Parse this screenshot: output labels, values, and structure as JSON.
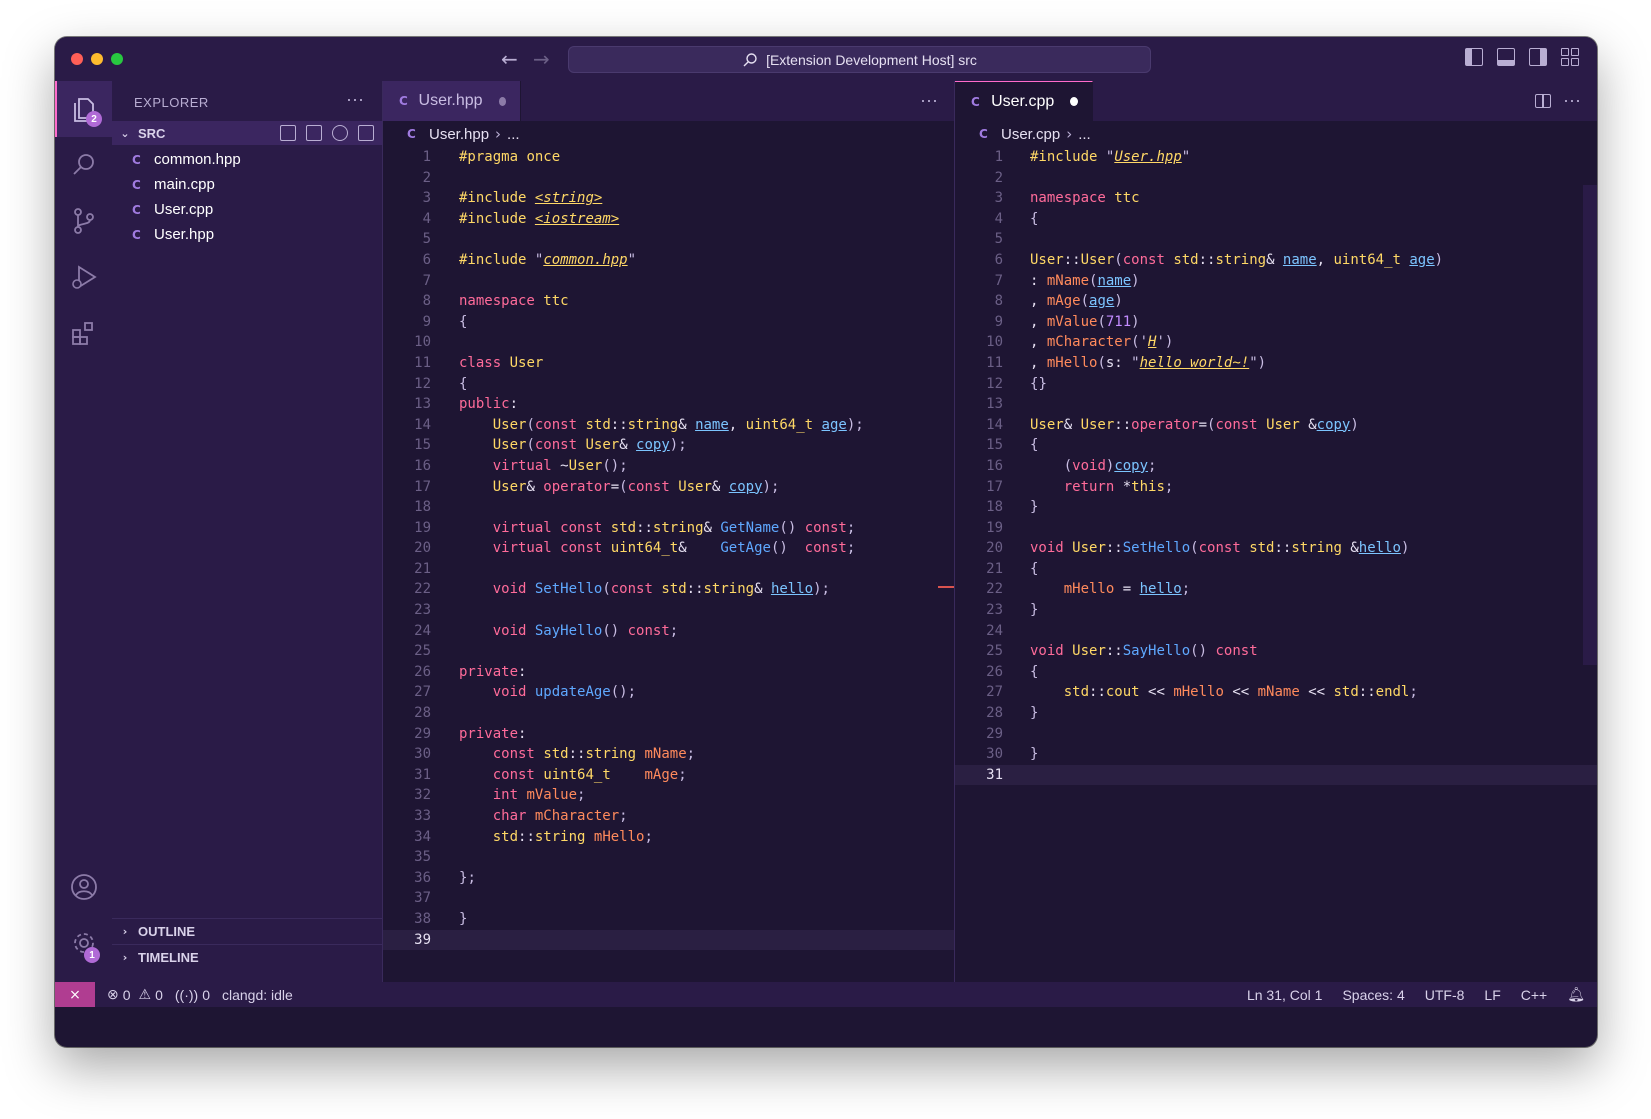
{
  "titlebar": {
    "search_text": "[Extension Development Host] src",
    "back_icon": "arrow-left-icon",
    "forward_icon": "arrow-right-icon"
  },
  "activity": {
    "explorer_badge": "2",
    "settings_badge": "1"
  },
  "sidebar": {
    "header": "EXPLORER",
    "folder": "SRC",
    "files": [
      "common.hpp",
      "main.cpp",
      "User.cpp",
      "User.hpp"
    ],
    "outline": "OUTLINE",
    "timeline": "TIMELINE"
  },
  "editor_left": {
    "tab": "User.hpp",
    "breadcrumb_file": "User.hpp",
    "breadcrumb_more": "...",
    "current_line": 39,
    "lines": [
      "#pragma once",
      "",
      "#include <string>",
      "#include <iostream>",
      "",
      "#include \"common.hpp\"",
      "",
      "namespace ttc",
      "{",
      "",
      "class User",
      "{",
      "public:",
      "    User(const std::string& name, uint64_t age);",
      "    User(const User& copy);",
      "    virtual ~User();",
      "    User& operator=(const User& copy);",
      "",
      "    virtual const std::string& GetName() const;",
      "    virtual const uint64_t&    GetAge()  const;",
      "",
      "    void SetHello(const std::string& hello);",
      "",
      "    void SayHello() const;",
      "",
      "private:",
      "    void updateAge();",
      "",
      "private:",
      "    const std::string mName;",
      "    const uint64_t    mAge;",
      "    int mValue;",
      "    char mCharacter;",
      "    std::string mHello;",
      "",
      "};",
      "",
      "}",
      ""
    ]
  },
  "editor_right": {
    "tab": "User.cpp",
    "breadcrumb_file": "User.cpp",
    "breadcrumb_more": "...",
    "current_line": 31,
    "lines": [
      "#include \"User.hpp\"",
      "",
      "namespace ttc",
      "{",
      "",
      "User::User(const std::string& name, uint64_t age)",
      ": mName(name)",
      ", mAge(age)",
      ", mValue(711)",
      ", mCharacter('H')",
      ", mHello(s: \"hello world~!\")",
      "{}",
      "",
      "User& User::operator=(const User &copy)",
      "{",
      "    (void)copy;",
      "    return *this;",
      "}",
      "",
      "void User::SetHello(const std::string &hello)",
      "{",
      "    mHello = hello;",
      "}",
      "",
      "void User::SayHello() const",
      "{",
      "    std::cout << mHello << mName << std::endl;",
      "}",
      "",
      "}",
      ""
    ]
  },
  "statusbar": {
    "errors": "0",
    "warnings": "0",
    "ports": "0",
    "clangd": "clangd: idle",
    "position": "Ln 31, Col 1",
    "spaces": "Spaces: 4",
    "encoding": "UTF-8",
    "eol": "LF",
    "language": "C++"
  }
}
